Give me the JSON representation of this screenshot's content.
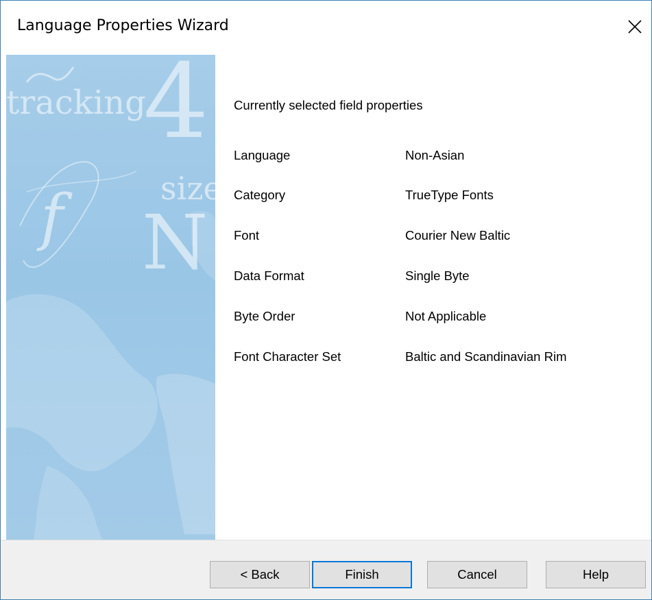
{
  "window": {
    "title": "Language Properties Wizard",
    "close_label": "×"
  },
  "side_panel": {
    "words": [
      "tracking",
      "4",
      "size",
      "N",
      "f"
    ]
  },
  "content": {
    "heading": "Currently selected field properties",
    "properties": [
      {
        "label": "Language",
        "value": "Non-Asian"
      },
      {
        "label": "Category",
        "value": "TrueType Fonts"
      },
      {
        "label": "Font",
        "value": "Courier New Baltic"
      },
      {
        "label": "Data Format",
        "value": "Single Byte"
      },
      {
        "label": "Byte Order",
        "value": "Not Applicable"
      },
      {
        "label": "Font Character Set",
        "value": "Baltic and Scandinavian Rim"
      }
    ]
  },
  "buttons": {
    "back": "< Back",
    "finish": "Finish",
    "cancel": "Cancel",
    "help": "Help"
  },
  "colors": {
    "accent": "#0078d7",
    "window_border": "#3c7fb1",
    "side_panel": "#a6cde9",
    "footer": "#f0f0f0"
  }
}
